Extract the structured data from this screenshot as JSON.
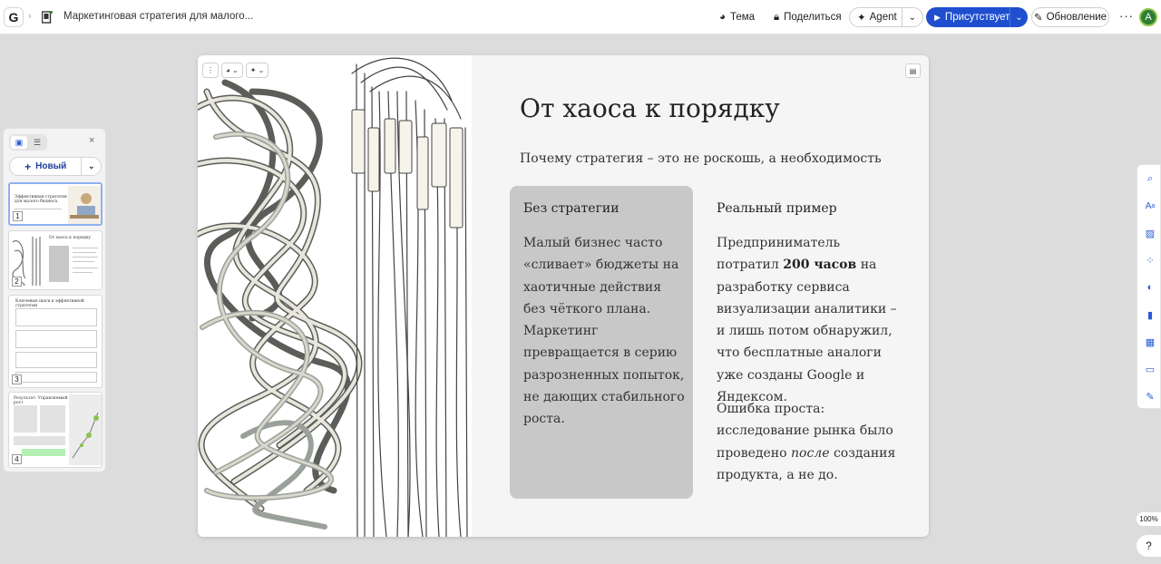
{
  "topbar": {
    "logo_letter": "G",
    "doc_title": "Маркетинговая стратегия для малого...",
    "theme_label": "Тема",
    "share_label": "Поделиться",
    "agent_label": "Agent",
    "present_label": "Присутствует",
    "update_label": "Обновление",
    "more_label": "···",
    "avatar_letter": "A",
    "accent_color": "#1f4fcf"
  },
  "panel": {
    "new_label": "Новый",
    "close_label": "×",
    "slides": [
      {
        "number": "1",
        "title": "Эффективная стратегия для малого бизнеса"
      },
      {
        "number": "2",
        "title": "От хаоса к порядку"
      },
      {
        "number": "3",
        "title": "Ключевые шаги к эффективной стратегии"
      },
      {
        "number": "4",
        "title": "Результат: Управляемый рост"
      }
    ]
  },
  "slide": {
    "title": "От хаоса к порядку",
    "subtitle": "Почему стратегия – это не роскошь, а необходимость",
    "card_heading": "Без стратегии",
    "card_body": "Малый бизнес часто «сливает» бюджеты на хаотичные действия без чёткого плана. Маркетинг превращается в серию разрозненных попыток, не дающих стабильного роста.",
    "col2_heading": "Реальный пример",
    "col2_p1_before": "Предприниматель потратил ",
    "col2_p1_bold": "200 часов",
    "col2_p1_after": " на разработку сервиса визуализации аналитики – и лишь потом обнаружил, что бесплатные аналоги уже созданы Google и Яндексом.",
    "col2_p2_before": "Ошибка проста: исследование рынка было проведено ",
    "col2_p2_italic": "после",
    "col2_p2_after": " создания продукта, а не до."
  },
  "zoom_label": "100%",
  "help_label": "?"
}
